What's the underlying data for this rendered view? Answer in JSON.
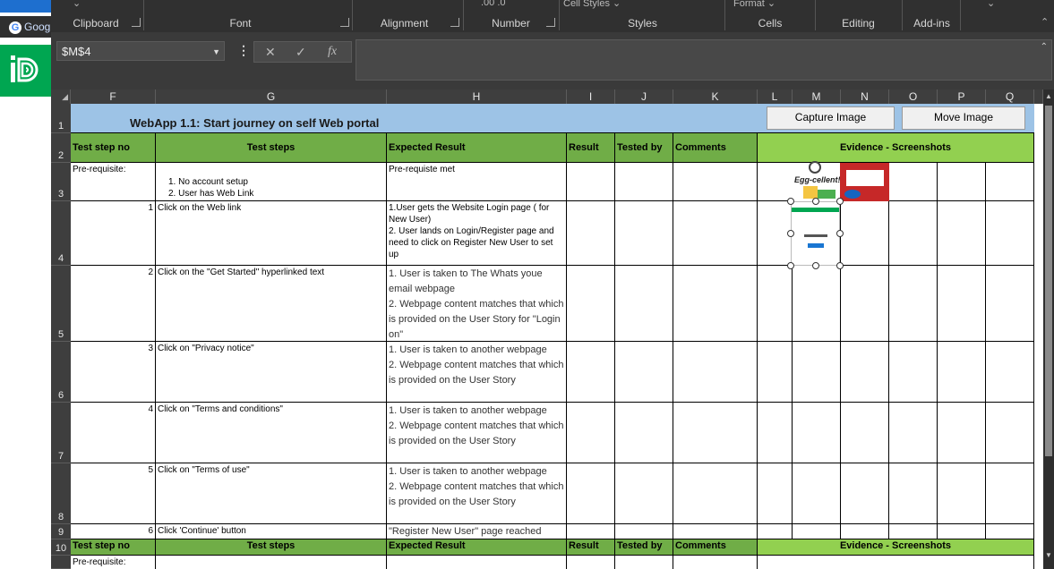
{
  "taskbar": {
    "google_label": "Goog",
    "google_glyph": "G",
    "app_icon": "id-app-icon"
  },
  "ribbon": {
    "groups": [
      "Clipboard",
      "Font",
      "Alignment",
      "Number",
      "Styles",
      "Cells",
      "Editing",
      "Add-ins"
    ],
    "fragments": {
      "cell_styles": "Cell Styles",
      "format": "Format",
      "number_frag": ".00 .0"
    }
  },
  "formula_bar": {
    "name_box": "$M$4",
    "cancel_icon": "✕",
    "enter_icon": "✓",
    "fx_label": "fx",
    "content": ""
  },
  "columns": [
    "F",
    "G",
    "H",
    "I",
    "J",
    "K",
    "L",
    "M",
    "N",
    "O",
    "P",
    "Q"
  ],
  "rows": [
    "1",
    "2",
    "3",
    "4",
    "5",
    "6",
    "7",
    "8",
    "9",
    "10"
  ],
  "sheet": {
    "title": "WebApp 1.1: Start journey on self Web portal",
    "buttons": {
      "capture": "Capture Image",
      "move": "Move Image"
    },
    "header": {
      "step_no": "Test step no",
      "steps": "Test steps",
      "expected": "Expected Result",
      "result": "Result",
      "tested_by": "Tested by",
      "comments": "Comments",
      "evidence": "Evidence - Screenshots"
    },
    "prereq": {
      "label": "Pre-requisite:",
      "step_line1": "1. No account setup",
      "step_line2": "2. User has Web Link",
      "expected": "Pre-requiste met"
    },
    "steps": [
      {
        "no": "1",
        "text": "Click on the Web link",
        "expected": [
          "1.User gets the Website Login page ( for New User)",
          "2. User lands on Login/Register page and need to click on Register New User to set up"
        ]
      },
      {
        "no": "2",
        "text": "Click on the \"Get Started\" hyperlinked text",
        "expected": [
          "1. User is taken to The Whats youe email webpage",
          "2. Webpage content matches that which is provided on the User Story for \"Login on\""
        ]
      },
      {
        "no": "3",
        "text": "Click on \"Privacy notice\"",
        "expected": [
          "1. User is taken to another webpage",
          "2. Webpage content matches that which is provided on the User Story"
        ]
      },
      {
        "no": "4",
        "text": "Click on \"Terms and conditions\"",
        "expected": [
          "1. User is taken to another webpage",
          "2. Webpage content matches that which is provided on the User Story"
        ]
      },
      {
        "no": "5",
        "text": "Click on \"Terms of use\"",
        "expected": [
          "1. User is taken to another webpage",
          "2. Webpage content matches that which is provided on the User Story"
        ]
      },
      {
        "no": "6",
        "text": "Click 'Continue' button",
        "expected": [
          "\"Register New User\" page reached"
        ]
      }
    ],
    "row11_partial": "Pre-requisite:",
    "image_caption": "Egg-cellent!"
  },
  "colors": {
    "header_green": "#70ad47",
    "light_green": "#92d050",
    "title_blue": "#9dc3e6",
    "ribbon_bg": "#303030"
  }
}
